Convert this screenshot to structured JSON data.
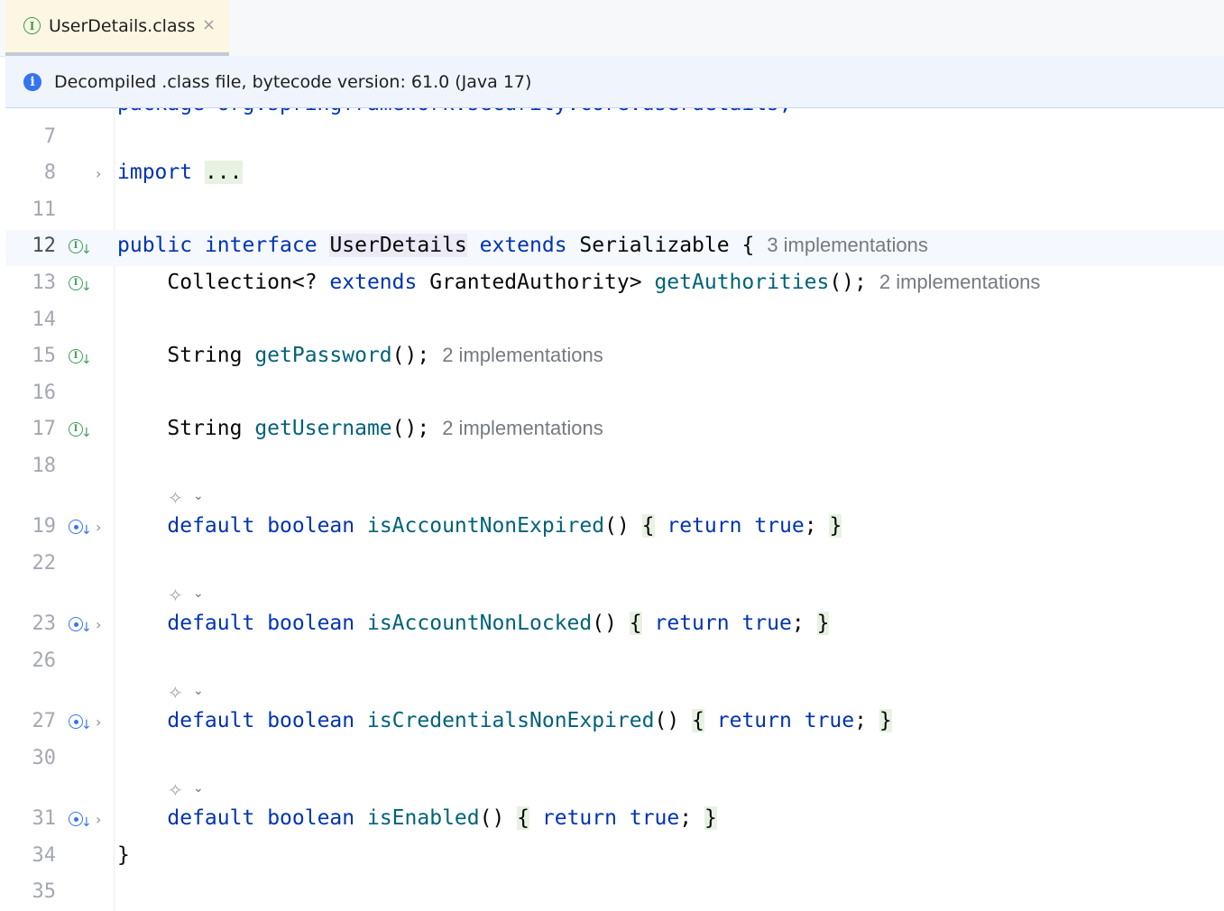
{
  "tab": {
    "title": "UserDetails.class",
    "close": "×",
    "icon": "I"
  },
  "banner": {
    "icon": "i",
    "text": "Decompiled .class file, bytecode version: 61.0 (Java 17)"
  },
  "partial_line": {
    "text": "package org.springframework.security.core.userdetails;"
  },
  "lines": {
    "l7": {
      "num": "7"
    },
    "l8": {
      "num": "8",
      "kw": "import",
      "folded": "..."
    },
    "l11": {
      "num": "11"
    },
    "l12": {
      "num": "12",
      "kw1": "public",
      "kw2": "interface",
      "name": "UserDetails",
      "kw3": "extends",
      "parent": "Serializable",
      "brace": "{",
      "hint": "3 implementations"
    },
    "l13": {
      "num": "13",
      "t1": "Collection<? ",
      "kw": "extends",
      "t2": " GrantedAuthority> ",
      "fn": "getAuthorities",
      "t3": "();",
      "hint": "2 implementations"
    },
    "l14": {
      "num": "14"
    },
    "l15": {
      "num": "15",
      "t1": "String ",
      "fn": "getPassword",
      "t2": "();",
      "hint": "2 implementations"
    },
    "l16": {
      "num": "16"
    },
    "l17": {
      "num": "17",
      "t1": "String ",
      "fn": "getUsername",
      "t2": "();",
      "hint": "2 implementations"
    },
    "l18": {
      "num": "18"
    },
    "l19": {
      "num": "19",
      "kw1": "default",
      "kw2": "boolean",
      "fn": "isAccountNonExpired",
      "parens": "()",
      "open": "{",
      "ret": "return",
      "val": "true",
      "semi": ";",
      "close": "}"
    },
    "l22": {
      "num": "22"
    },
    "l23": {
      "num": "23",
      "kw1": "default",
      "kw2": "boolean",
      "fn": "isAccountNonLocked",
      "parens": "()",
      "open": "{",
      "ret": "return",
      "val": "true",
      "semi": ";",
      "close": "}"
    },
    "l26": {
      "num": "26"
    },
    "l27": {
      "num": "27",
      "kw1": "default",
      "kw2": "boolean",
      "fn": "isCredentialsNonExpired",
      "parens": "()",
      "open": "{",
      "ret": "return",
      "val": "true",
      "semi": ";",
      "close": "}"
    },
    "l30": {
      "num": "30"
    },
    "l31": {
      "num": "31",
      "kw1": "default",
      "kw2": "boolean",
      "fn": "isEnabled",
      "parens": "()",
      "open": "{",
      "ret": "return",
      "val": "true",
      "semi": ";",
      "close": "}"
    },
    "l34": {
      "num": "34",
      "brace": "}"
    },
    "l35": {
      "num": "35"
    }
  },
  "gutter": {
    "implemented_icon": "I",
    "arrow": "↓",
    "fold_chevron": "›",
    "ai_icon": "✧",
    "ai_chevron": "⌄"
  },
  "colors": {
    "keyword": "#0033b3",
    "method": "#00627a",
    "hint": "#767a80",
    "implemented": "#3f9f58",
    "overrides": "#3574f0"
  }
}
